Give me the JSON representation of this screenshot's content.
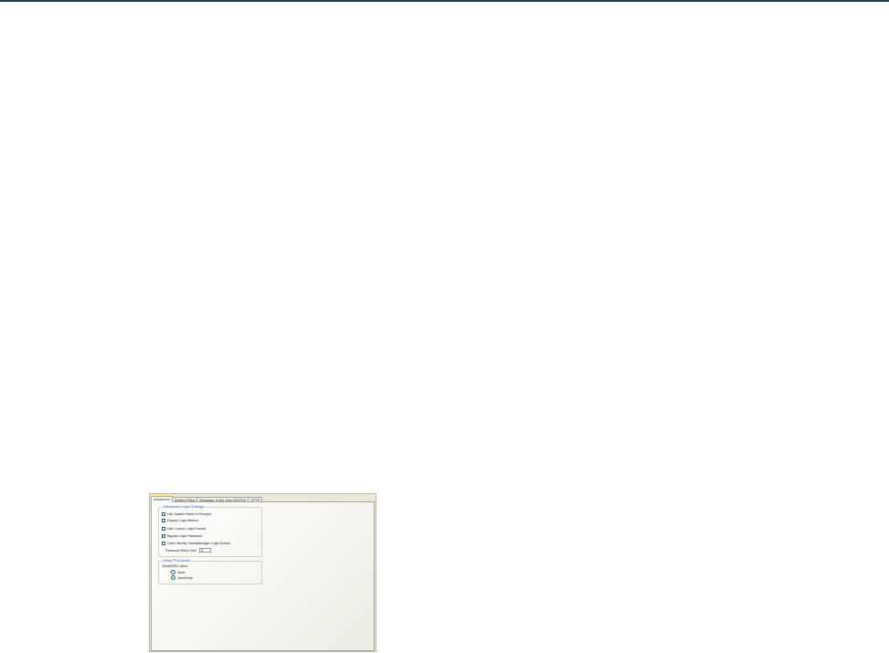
{
  "tabs": [
    {
      "label": "Advanced",
      "active": true
    },
    {
      "label": "Startup Files",
      "active": false
    },
    {
      "label": "Message of the Day (MOTD)",
      "active": false
    },
    {
      "label": "TFTP",
      "active": false
    }
  ],
  "advanced_login": {
    "legend": "Advanced Login Settings",
    "checkboxes": [
      {
        "label": "Use System Name in Prompts",
        "checked": false
      },
      {
        "label": "Display Login Banner",
        "checked": false
      },
      {
        "label": "Use Custom Login Format",
        "checked": false
      },
      {
        "label": "Bypass Login Password",
        "checked": false
      },
      {
        "label": "Cisco Identity VirtualManager Login Screen",
        "checked": false
      }
    ],
    "password_retry_label": "Password Retry Limit",
    "password_retry_value": "3"
  },
  "keep_alive": {
    "legend": "Keep-Port Mode",
    "sublabel": "Telnet/SSH Client",
    "options": [
      {
        "label": "None",
        "selected": false
      },
      {
        "label": "JavaScript",
        "selected": true
      }
    ]
  },
  "colors": {
    "accent_legend": "#1f5fbf",
    "active_tab_highlight": "#e3a21a",
    "top_rule": "#1f3d4f"
  }
}
